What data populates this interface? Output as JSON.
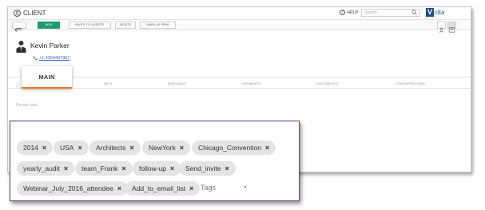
{
  "header": {
    "title": "CLIENT",
    "help_label": "HELP",
    "search_placeholder": "Search",
    "logo_mark": "V",
    "logo_text": "cita"
  },
  "toolbar": {
    "new_label": "NEW",
    "invite_label": "INVITE TO LIVESITE",
    "delete_label": "DELETE",
    "mark_spam_label": "MARK AS SPAM"
  },
  "client": {
    "name": "Kevin Parker",
    "phone": "+1 4364487967"
  },
  "tabs": {
    "main": "MAIN",
    "items": [
      "INFO",
      "BOOKINGS",
      "PAYMENTS",
      "DOCUMENTS",
      "CONVERSATIONS"
    ]
  },
  "private_note_placeholder": "Private note...",
  "tags": {
    "items": [
      "2014",
      "USA",
      "Architects",
      "NewYork",
      "Chicago_Convention",
      "yearly_audit",
      "team_Frank",
      "follow-up",
      "Send_invite",
      "Webinar_July_2016_attendee",
      "Add_to_email_list"
    ],
    "remove_glyph": "×",
    "input_placeholder": "Tags"
  },
  "colors": {
    "accent_green": "#1e9a6e",
    "tab_underline": "#e87a1d",
    "highlight_border": "#6a3a7e",
    "phone_link": "#3a66c4"
  }
}
